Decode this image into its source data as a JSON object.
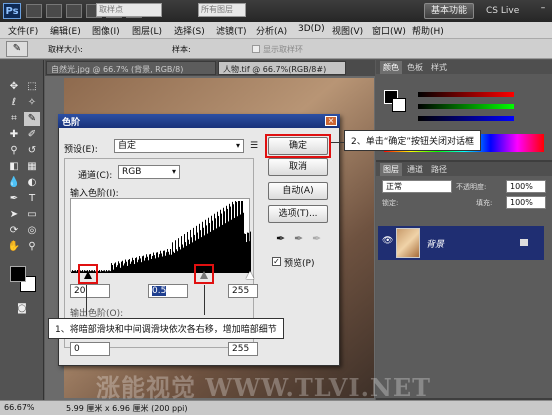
{
  "app": {
    "workspace_button": "基本功能",
    "cslive": "CS Live",
    "menu": [
      "文件(F)",
      "编辑(E)",
      "图像(I)",
      "图层(L)",
      "选择(S)",
      "滤镜(T)",
      "分析(A)",
      "3D(D)",
      "视图(V)",
      "窗口(W)",
      "帮助(H)"
    ]
  },
  "options": {
    "sample_size_label": "取样大小:",
    "sample_size_value": "取样点",
    "sample_label": "样本:",
    "sample_value": "所有图层",
    "show_ring_label": "显示取样环"
  },
  "doc_tabs": [
    "自然光.jpg @ 66.7% (背景, RGB/8)",
    "人物.tif @ 66.7%(RGB/8#)"
  ],
  "panels": {
    "color_tabs": [
      "颜色",
      "色板",
      "样式"
    ],
    "layer_tabs": [
      "图层",
      "通道",
      "路径"
    ],
    "blend_mode": "正常",
    "opacity_label": "不透明度:",
    "opacity_value": "100%",
    "fill_label": "填充:",
    "fill_value": "100%",
    "lock_label": "锁定:",
    "layer_name": "背景"
  },
  "dialog": {
    "title": "色阶",
    "preset_label": "预设(E):",
    "preset_value": "自定",
    "channel_label": "通道(C):",
    "channel_value": "RGB",
    "input_levels_label": "输入色阶(I):",
    "input_black": "20",
    "input_gamma": "0.5",
    "input_white": "255",
    "output_levels_label": "输出色阶(O):",
    "output_black": "0",
    "output_white": "255",
    "buttons": {
      "ok": "确定",
      "cancel": "取消",
      "auto": "自动(A)",
      "options": "选项(T)..."
    },
    "preview_label": "预览(P)",
    "preview_checked": true
  },
  "callouts": {
    "step2": "2、单击“确定”按钮关闭对话框",
    "step1": "1、将暗部滑块和中间调滑块依次各右移，增加暗部细节"
  },
  "status": {
    "zoom": "66.67%",
    "doc_info": "5.99 厘米 x 6.96 厘米 (200 ppi)"
  },
  "watermark": "涨能视觉 WWW.TLVI.NET",
  "colors": {
    "highlight_red": "#e01010",
    "dialog_title_blue": "#1f3f8f",
    "layer_select_blue": "#1f2e72"
  }
}
